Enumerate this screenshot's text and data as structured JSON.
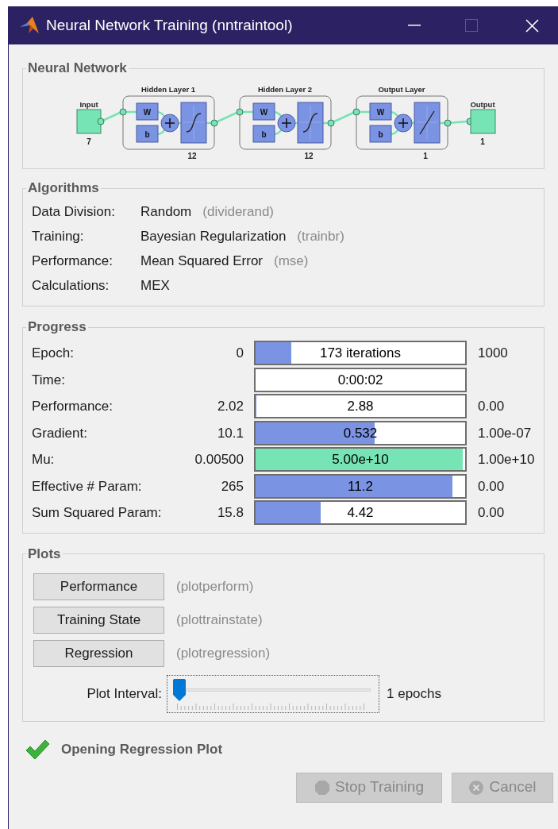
{
  "window": {
    "title": "Neural Network Training (nntraintool)"
  },
  "network": {
    "title": "Neural Network",
    "input": {
      "label": "Input",
      "size": "7"
    },
    "output": {
      "label": "Output",
      "size": "1"
    },
    "layers": [
      {
        "title": "Hidden Layer 1",
        "size": "12",
        "weight": "W",
        "bias": "b",
        "kind": "sigmoid"
      },
      {
        "title": "Hidden Layer 2",
        "size": "12",
        "weight": "W",
        "bias": "b",
        "kind": "sigmoid"
      },
      {
        "title": "Output Layer",
        "size": "1",
        "weight": "W",
        "bias": "b",
        "kind": "linear"
      }
    ]
  },
  "algorithms": {
    "title": "Algorithms",
    "rows": [
      {
        "label": "Data Division:",
        "value": "Random",
        "function": "(dividerand)"
      },
      {
        "label": "Training:",
        "value": "Bayesian Regularization",
        "function": "(trainbr)"
      },
      {
        "label": "Performance:",
        "value": "Mean Squared Error",
        "function": "(mse)"
      },
      {
        "label": "Calculations:",
        "value": "MEX"
      }
    ]
  },
  "progress": {
    "title": "Progress",
    "rows": [
      {
        "label": "Epoch:",
        "start": "0",
        "reading": "173 iterations",
        "level": 0.17,
        "color": "#7b93e3",
        "end": "1000"
      },
      {
        "label": "Time:",
        "reading": "0:00:02"
      },
      {
        "label": "Performance:",
        "start": "2.02",
        "reading": "2.88",
        "level": 0.005,
        "color": "#7b93e3",
        "end": "0.00"
      },
      {
        "label": "Gradient:",
        "start": "10.1",
        "reading": "0.532",
        "level": 0.57,
        "color": "#7b93e3",
        "end": "1.00e-07"
      },
      {
        "label": "Mu:",
        "start": "0.00500",
        "reading": "5.00e+10",
        "level": 0.99,
        "color": "#76e4b4",
        "end": "1.00e+10"
      },
      {
        "label": "Effective # Param:",
        "start": "265",
        "reading": "11.2",
        "level": 0.94,
        "color": "#7b93e3",
        "end": "0.00"
      },
      {
        "label": "Sum Squared Param:",
        "start": "15.8",
        "reading": "4.42",
        "level": 0.31,
        "color": "#7b93e3",
        "end": "0.00"
      }
    ]
  },
  "plots": {
    "title": "Plots",
    "buttons": [
      {
        "label": "Performance",
        "function": "(plotperform)"
      },
      {
        "label": "Training State",
        "function": "(plottrainstate)"
      },
      {
        "label": "Regression",
        "function": "(plotregression)"
      }
    ],
    "interval": {
      "label": "Plot Interval:",
      "level": 0,
      "reading": "1 epochs"
    }
  },
  "status": {
    "text": "Opening Regression Plot"
  },
  "buttons": [
    {
      "label": "Stop Training",
      "kind": "stop",
      "disabled": true
    },
    {
      "label": "Cancel",
      "kind": "cancel",
      "disabled": true
    }
  ]
}
